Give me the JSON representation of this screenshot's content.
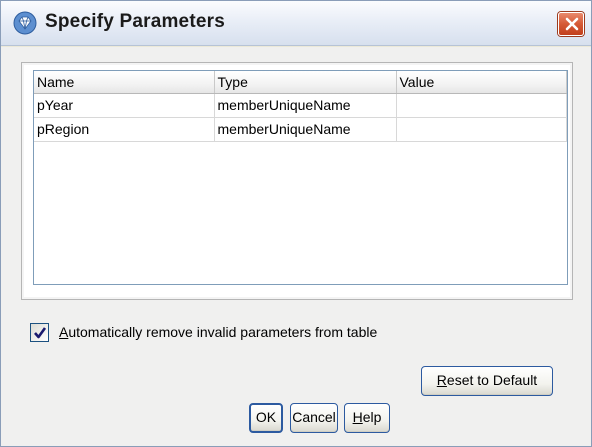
{
  "window": {
    "title": "Specify Parameters",
    "icon": "gem-icon",
    "close_icon": "close-icon"
  },
  "table": {
    "columns": [
      "Name",
      "Type",
      "Value"
    ],
    "rows": [
      {
        "name": "pYear",
        "type": "memberUniqueName",
        "value": ""
      },
      {
        "name": "pRegion",
        "type": "memberUniqueName",
        "value": ""
      }
    ]
  },
  "options": {
    "auto_remove": {
      "checked": true,
      "label_mnemonic": "A",
      "label_rest": "utomatically remove invalid parameters from table"
    }
  },
  "buttons": {
    "reset_mnemonic": "R",
    "reset_rest": "eset to Default",
    "ok": "OK",
    "cancel": "Cancel",
    "help_mnemonic": "H",
    "help_rest": "elp"
  },
  "colors": {
    "close_button": "#d55a36",
    "button_border": "#2c5aa0",
    "checkbox_check": "#1a1a6e"
  }
}
